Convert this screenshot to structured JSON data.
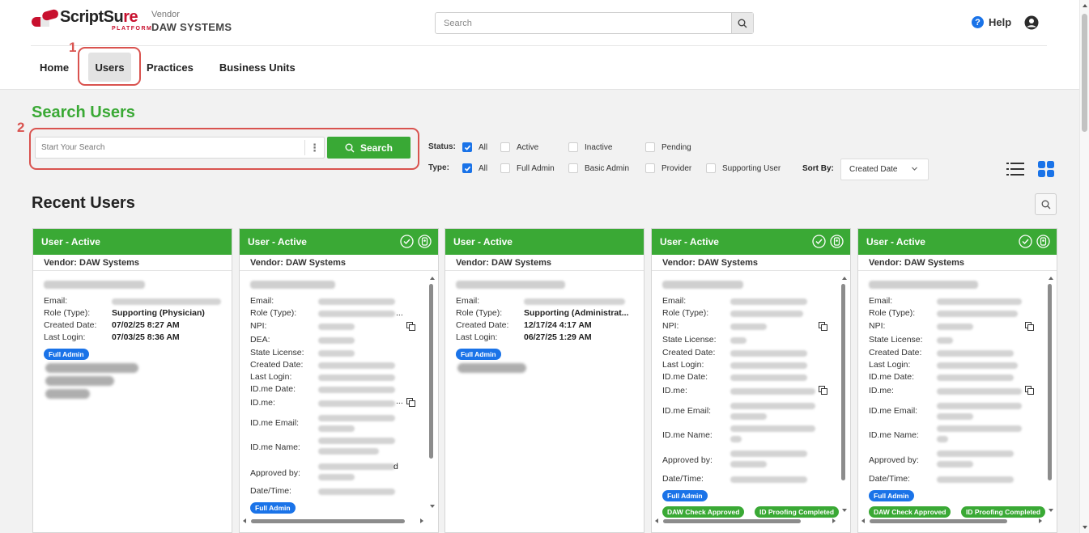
{
  "header": {
    "logo": {
      "text_main": "ScriptSu",
      "text_accent": "re",
      "sub": "PLATFORM"
    },
    "vendor_caption": "Vendor",
    "vendor_name": "DAW SYSTEMS",
    "search_placeholder": "Search",
    "help_label": "Help"
  },
  "nav": {
    "items": [
      {
        "label": "Home"
      },
      {
        "label": "Users"
      },
      {
        "label": "Practices"
      },
      {
        "label": "Business Units"
      }
    ]
  },
  "annotations": {
    "one": "1",
    "two": "2"
  },
  "search_users": {
    "title": "Search Users",
    "input_placeholder": "Start Your Search",
    "menu_glyph": "⋮",
    "button_label": "Search"
  },
  "filters": {
    "status_label": "Status:",
    "status_options": [
      "All",
      "Active",
      "Inactive",
      "Pending"
    ],
    "type_label": "Type:",
    "type_options": [
      "All",
      "Full Admin",
      "Basic Admin",
      "Provider",
      "Supporting User"
    ],
    "sort_label": "Sort By:",
    "sort_value": "Created Date"
  },
  "recent": {
    "title": "Recent Users"
  },
  "cards": [
    {
      "status": "User - Active",
      "vendor": "Vendor: DAW Systems",
      "labels": {
        "email": "Email:",
        "role": "Role (Type):",
        "created": "Created Date:",
        "login": "Last Login:"
      },
      "role": "Supporting (Physician)",
      "created": "07/02/25 8:27 AM",
      "login": "07/03/25 8:36 AM",
      "badge": "Full Admin"
    },
    {
      "status": "User - Active",
      "vendor": "Vendor: DAW Systems",
      "labels": {
        "email": "Email:",
        "role": "Role (Type):",
        "npi": "NPI:",
        "dea": "DEA:",
        "state": "State License:",
        "created": "Created Date:",
        "login": "Last Login:",
        "idme_date": "ID.me Date:",
        "idme": "ID.me:",
        "idme_email": "ID.me Email:",
        "idme_name": "ID.me Name:",
        "approved": "Approved by:",
        "datetime": "Date/Time:"
      },
      "role_blur_suffix": "...",
      "approved_suffix": "d",
      "badge": "Full Admin"
    },
    {
      "status": "User - Active",
      "vendor": "Vendor: DAW Systems",
      "labels": {
        "email": "Email:",
        "role": "Role (Type):",
        "created": "Created Date:",
        "login": "Last Login:"
      },
      "role": "Supporting (Administrat...",
      "created": "12/17/24 4:17 AM",
      "login": "06/27/25 1:29 AM",
      "badge": "Full Admin"
    },
    {
      "status": "User - Active",
      "vendor": "Vendor: DAW Systems",
      "labels": {
        "email": "Email:",
        "role": "Role (Type):",
        "npi": "NPI:",
        "state": "State License:",
        "created": "Created Date:",
        "login": "Last Login:",
        "idme_date": "ID.me Date:",
        "idme": "ID.me:",
        "idme_email": "ID.me Email:",
        "idme_name": "ID.me Name:",
        "approved": "Approved by:",
        "datetime": "Date/Time:"
      },
      "badge": "Full Admin",
      "badge_green_1": "DAW Check Approved",
      "badge_green_2": "ID Proofing Completed"
    },
    {
      "status": "User - Active",
      "vendor": "Vendor: DAW Systems",
      "labels": {
        "email": "Email:",
        "role": "Role (Type):",
        "npi": "NPI:",
        "state": "State License:",
        "created": "Created Date:",
        "login": "Last Login:",
        "idme_date": "ID.me Date:",
        "idme": "ID.me:",
        "idme_email": "ID.me Email:",
        "idme_name": "ID.me Name:",
        "approved": "Approved by:",
        "datetime": "Date/Time:"
      },
      "badge": "Full Admin",
      "badge_green_1": "DAW Check Approved",
      "badge_green_2": "ID Proofing Completed"
    }
  ],
  "colors": {
    "brand_green": "#3aa935",
    "brand_red": "#c8102e",
    "accent_blue": "#1a73e8",
    "callout_red": "#d9534f"
  }
}
